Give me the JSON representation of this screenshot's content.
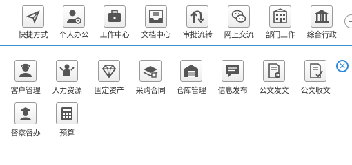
{
  "top_nav": [
    {
      "label": "快捷方式",
      "icon": "paper-plane-icon"
    },
    {
      "label": "个人办公",
      "icon": "person-settings-icon"
    },
    {
      "label": "工作中心",
      "icon": "briefcase-icon"
    },
    {
      "label": "文档中心",
      "icon": "inbox-tray-icon"
    },
    {
      "label": "审批流转",
      "icon": "flow-arrows-icon"
    },
    {
      "label": "网上交流",
      "icon": "chat-bubbles-icon"
    },
    {
      "label": "部门工作",
      "icon": "building-icon"
    },
    {
      "label": "综合行政",
      "icon": "government-building-icon"
    }
  ],
  "modules": [
    {
      "label": "客户管理",
      "icon": "customer-icon"
    },
    {
      "label": "人力资源",
      "icon": "people-icon"
    },
    {
      "label": "固定资产",
      "icon": "diamond-icon"
    },
    {
      "label": "采购合同",
      "icon": "contract-stamp-icon"
    },
    {
      "label": "仓库管理",
      "icon": "warehouse-icon"
    },
    {
      "label": "信息发布",
      "icon": "message-icon"
    },
    {
      "label": "公文发文",
      "icon": "document-send-icon"
    },
    {
      "label": "公文收文",
      "icon": "document-receive-icon"
    },
    {
      "label": "督察督办",
      "icon": "police-officer-icon"
    },
    {
      "label": "预算",
      "icon": "budget-calculator-icon"
    }
  ],
  "colors": {
    "accent": "#2e8ad8",
    "divider": "#3c8fd0"
  }
}
